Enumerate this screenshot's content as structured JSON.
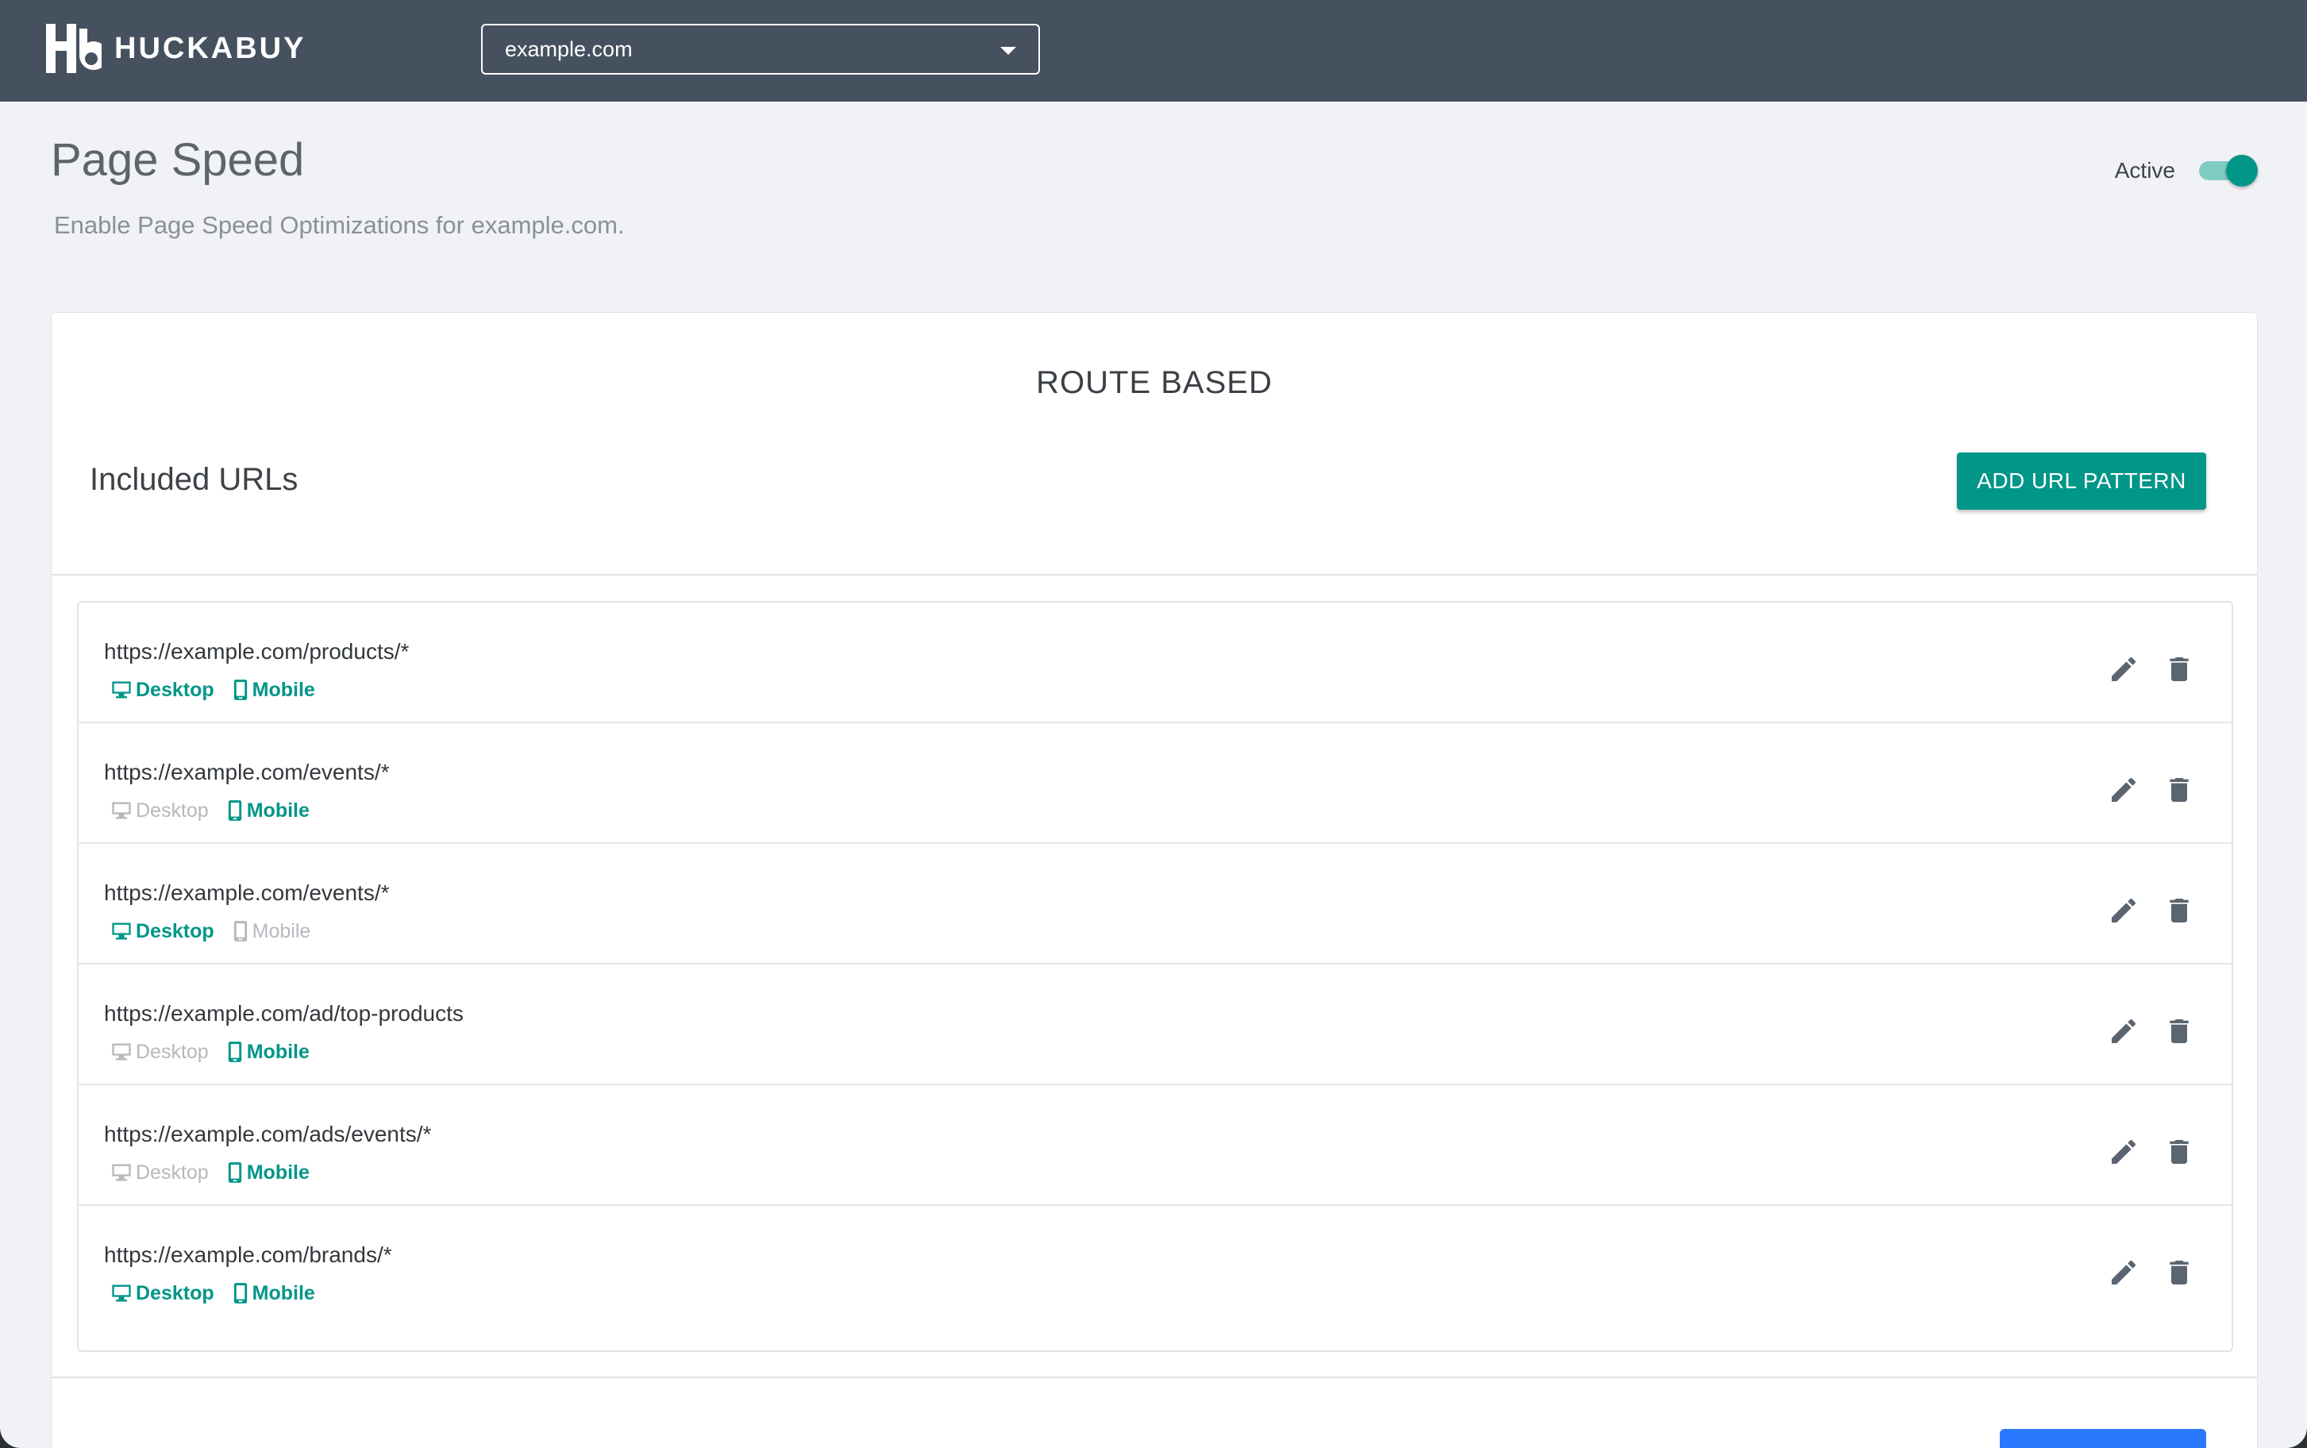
{
  "header": {
    "brand": "HUCKABUY",
    "site_selector": {
      "value": "example.com"
    }
  },
  "page": {
    "title": "Page Speed",
    "subtitle": "Enable Page Speed Optimizations for example.com.",
    "active_label": "Active",
    "active": true
  },
  "route_section": {
    "title": "ROUTE BASED",
    "included_title": "Included URLs",
    "add_button": "ADD URL PATTERN",
    "device_labels": {
      "desktop": "Desktop",
      "mobile": "Mobile"
    },
    "rules": [
      {
        "url": "https://example.com/products/*",
        "desktop": true,
        "mobile": true
      },
      {
        "url": "https://example.com/events/*",
        "desktop": false,
        "mobile": true
      },
      {
        "url": "https://example.com/events/*",
        "desktop": true,
        "mobile": false
      },
      {
        "url": "https://example.com/ad/top-products",
        "desktop": false,
        "mobile": true
      },
      {
        "url": "https://example.com/ads/events/*",
        "desktop": false,
        "mobile": true
      },
      {
        "url": "https://example.com/brands/*",
        "desktop": true,
        "mobile": true
      }
    ]
  },
  "colors": {
    "topbar": "#465160",
    "accent": "#009688",
    "inactive_device": "#b5b9be",
    "icon": "#5a6570",
    "secondary_button": "#2979ff"
  },
  "icons": {
    "edit": "pencil-icon",
    "delete": "trash-icon",
    "desktop": "monitor-icon",
    "mobile": "smartphone-icon"
  }
}
